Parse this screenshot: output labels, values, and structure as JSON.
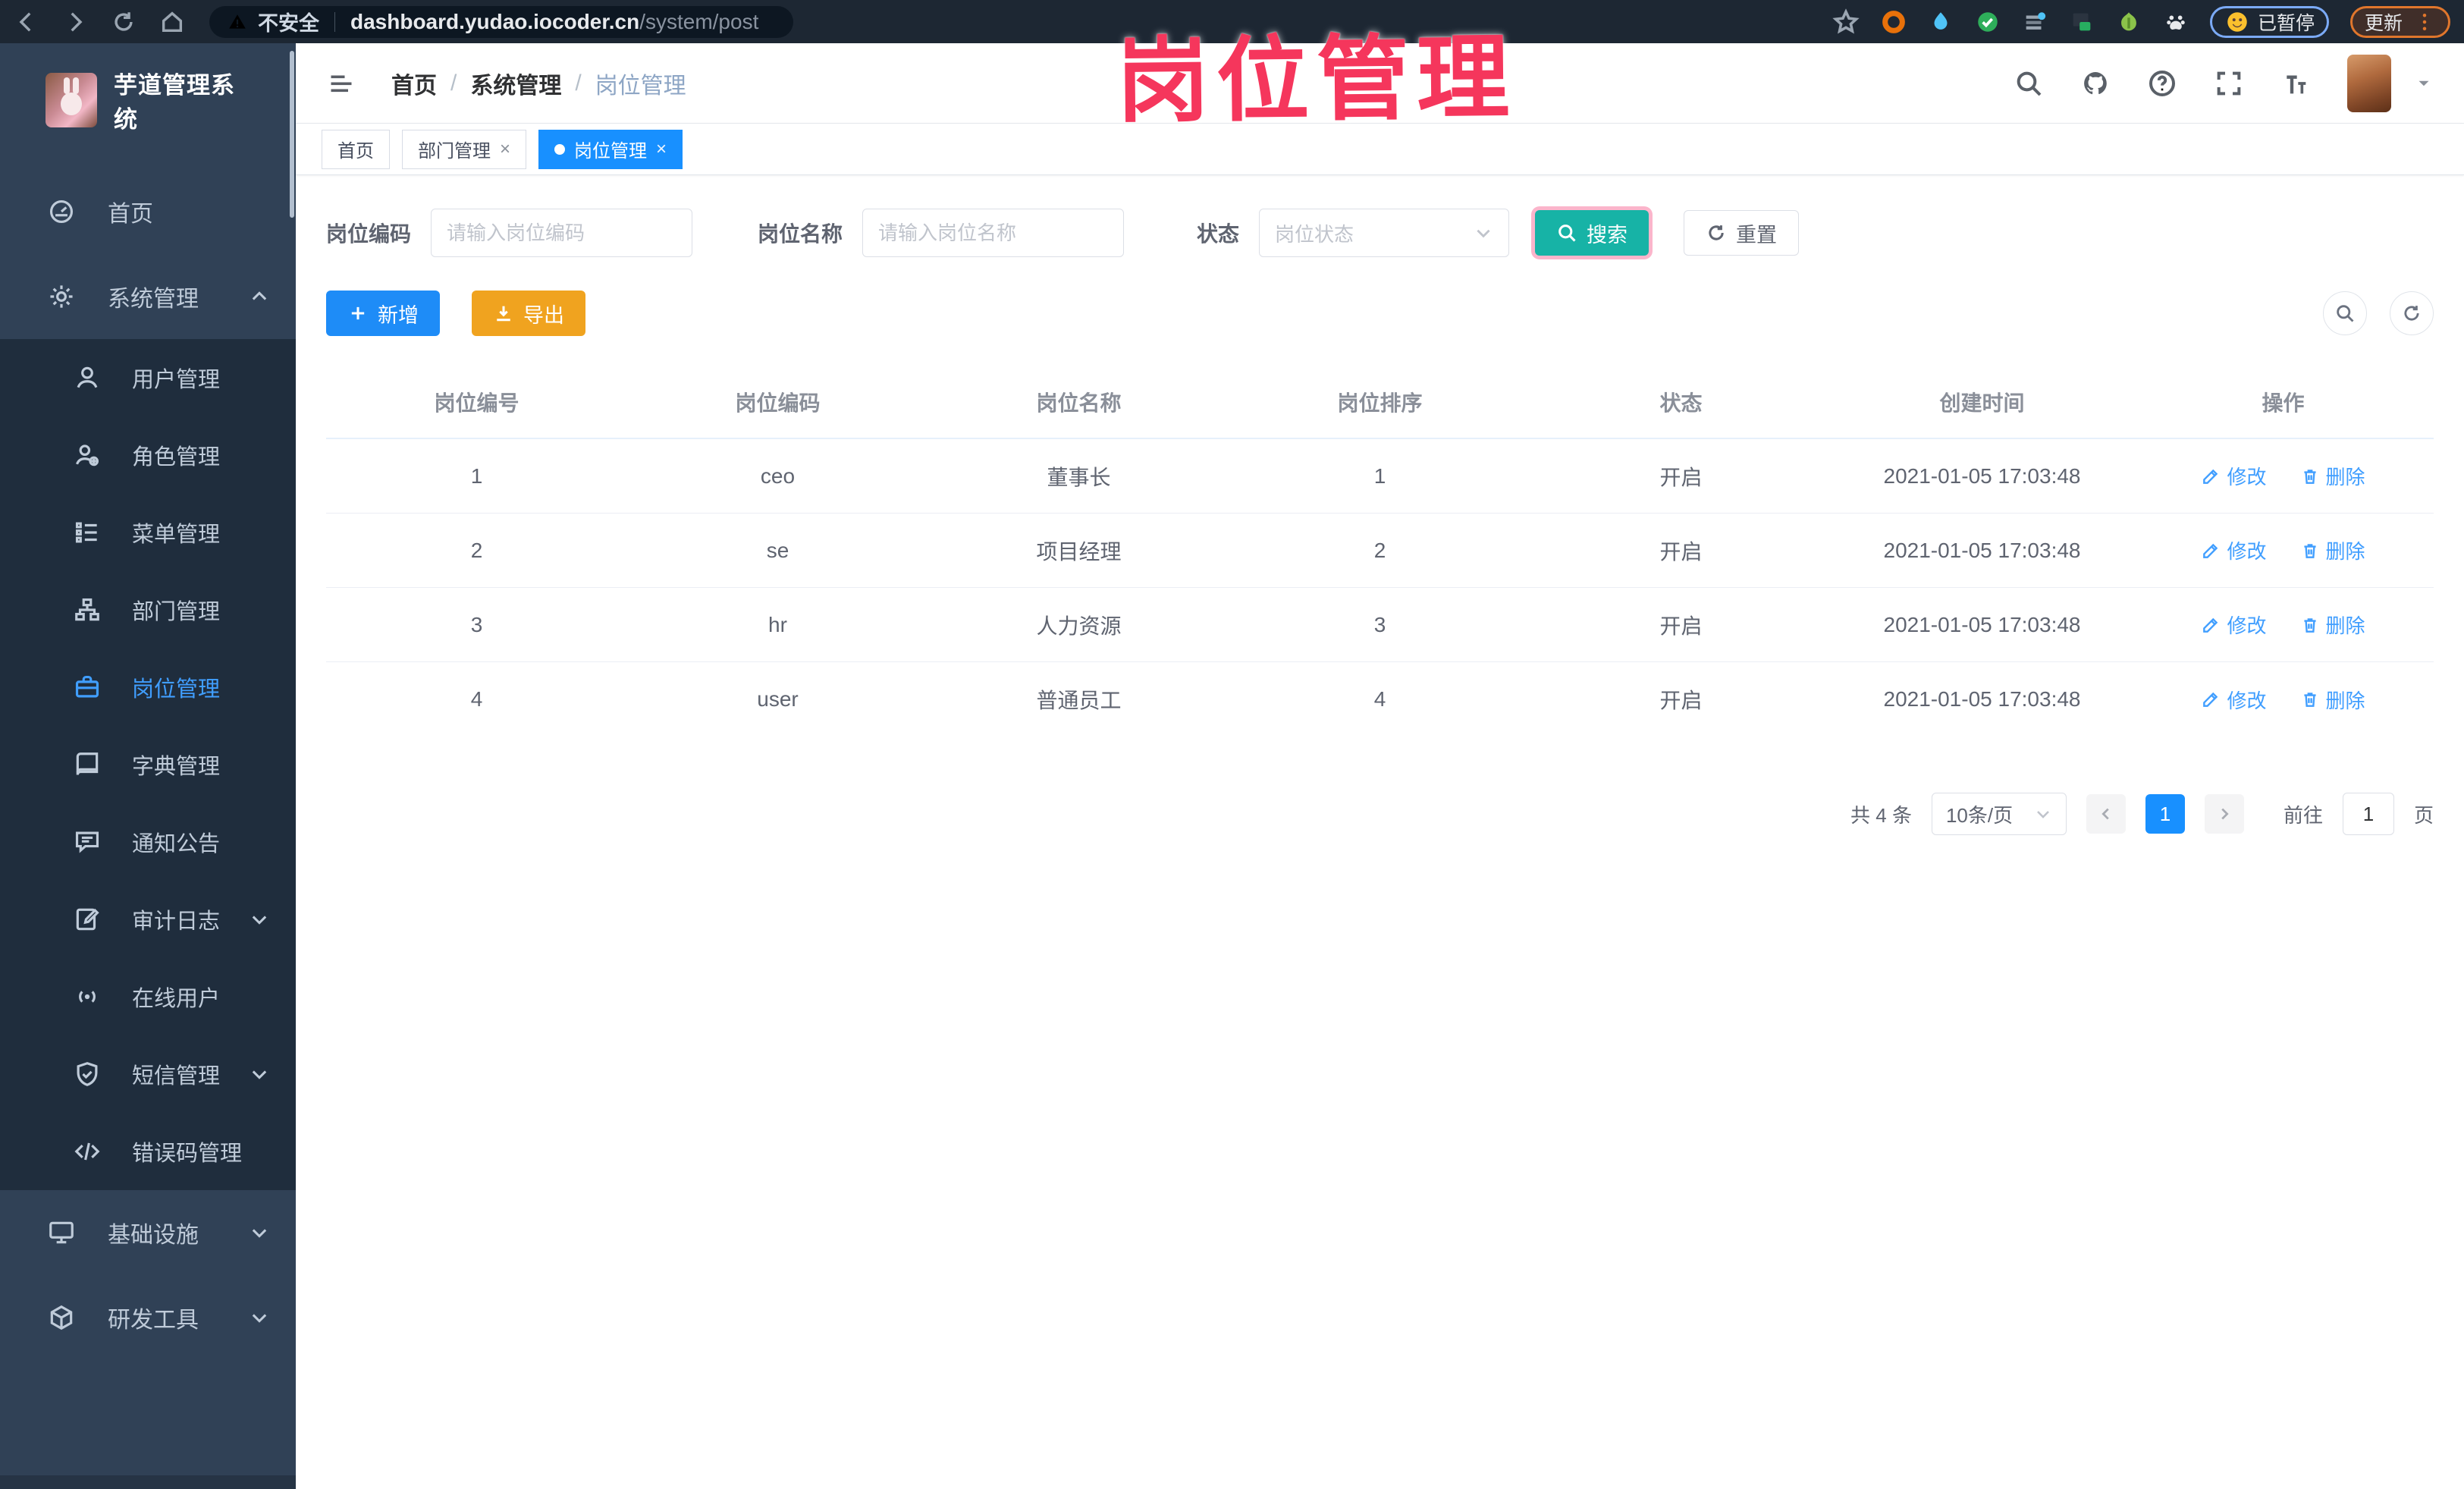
{
  "annotation": {
    "text": "岗位管理",
    "color": "#f5365c"
  },
  "browser": {
    "security_label": "不安全",
    "url_host": "dashboard.yudao.iocoder.cn",
    "url_path": "/system/post",
    "paused_label": "已暂停",
    "update_label": "更新"
  },
  "icons": {
    "close": "×",
    "breadcrumb_separator": "/"
  },
  "sidebar": {
    "title": "芋道管理系统",
    "items": [
      {
        "label": "首页",
        "icon": "dashboard-icon",
        "level": 1
      },
      {
        "label": "系统管理",
        "icon": "gear-icon",
        "level": 1,
        "chevron": "up",
        "expanded": true
      },
      {
        "label": "用户管理",
        "icon": "user-icon",
        "level": 2
      },
      {
        "label": "角色管理",
        "icon": "role-icon",
        "level": 2
      },
      {
        "label": "菜单管理",
        "icon": "menu-list-icon",
        "level": 2
      },
      {
        "label": "部门管理",
        "icon": "dept-tree-icon",
        "level": 2
      },
      {
        "label": "岗位管理",
        "icon": "post-icon",
        "level": 2,
        "active": true
      },
      {
        "label": "字典管理",
        "icon": "dict-icon",
        "level": 2
      },
      {
        "label": "通知公告",
        "icon": "notice-icon",
        "level": 2
      },
      {
        "label": "审计日志",
        "icon": "audit-log-icon",
        "level": 2,
        "chevron": "down"
      },
      {
        "label": "在线用户",
        "icon": "online-user-icon",
        "level": 2
      },
      {
        "label": "短信管理",
        "icon": "sms-icon",
        "level": 2,
        "chevron": "down"
      },
      {
        "label": "错误码管理",
        "icon": "error-code-icon",
        "level": 2
      },
      {
        "label": "基础设施",
        "icon": "infra-icon",
        "level": 1,
        "chevron": "down"
      },
      {
        "label": "研发工具",
        "icon": "dev-tools-icon",
        "level": 1,
        "chevron": "down"
      }
    ]
  },
  "header": {
    "breadcrumb": [
      "首页",
      "系统管理",
      "岗位管理"
    ]
  },
  "tabs": [
    {
      "label": "首页",
      "closable": false,
      "active": false
    },
    {
      "label": "部门管理",
      "closable": true,
      "active": false
    },
    {
      "label": "岗位管理",
      "closable": true,
      "active": true
    }
  ],
  "filters": {
    "code_label": "岗位编码",
    "code_placeholder": "请输入岗位编码",
    "name_label": "岗位名称",
    "name_placeholder": "请输入岗位名称",
    "status_label": "状态",
    "status_placeholder": "岗位状态",
    "search_label": "搜索",
    "reset_label": "重置"
  },
  "toolbar": {
    "add_label": "新增",
    "export_label": "导出"
  },
  "table": {
    "columns": [
      "岗位编号",
      "岗位编码",
      "岗位名称",
      "岗位排序",
      "状态",
      "创建时间",
      "操作"
    ],
    "edit_label": "修改",
    "delete_label": "删除",
    "rows": [
      {
        "id": "1",
        "code": "ceo",
        "name": "董事长",
        "sort": "1",
        "status": "开启",
        "created": "2021-01-05 17:03:48"
      },
      {
        "id": "2",
        "code": "se",
        "name": "项目经理",
        "sort": "2",
        "status": "开启",
        "created": "2021-01-05 17:03:48"
      },
      {
        "id": "3",
        "code": "hr",
        "name": "人力资源",
        "sort": "3",
        "status": "开启",
        "created": "2021-01-05 17:03:48"
      },
      {
        "id": "4",
        "code": "user",
        "name": "普通员工",
        "sort": "4",
        "status": "开启",
        "created": "2021-01-05 17:03:48"
      }
    ]
  },
  "pagination": {
    "total": "共 4 条",
    "page_size": "10条/页",
    "current_page": "1",
    "goto_label": "前往",
    "goto_value": "1",
    "page_unit": "页"
  }
}
